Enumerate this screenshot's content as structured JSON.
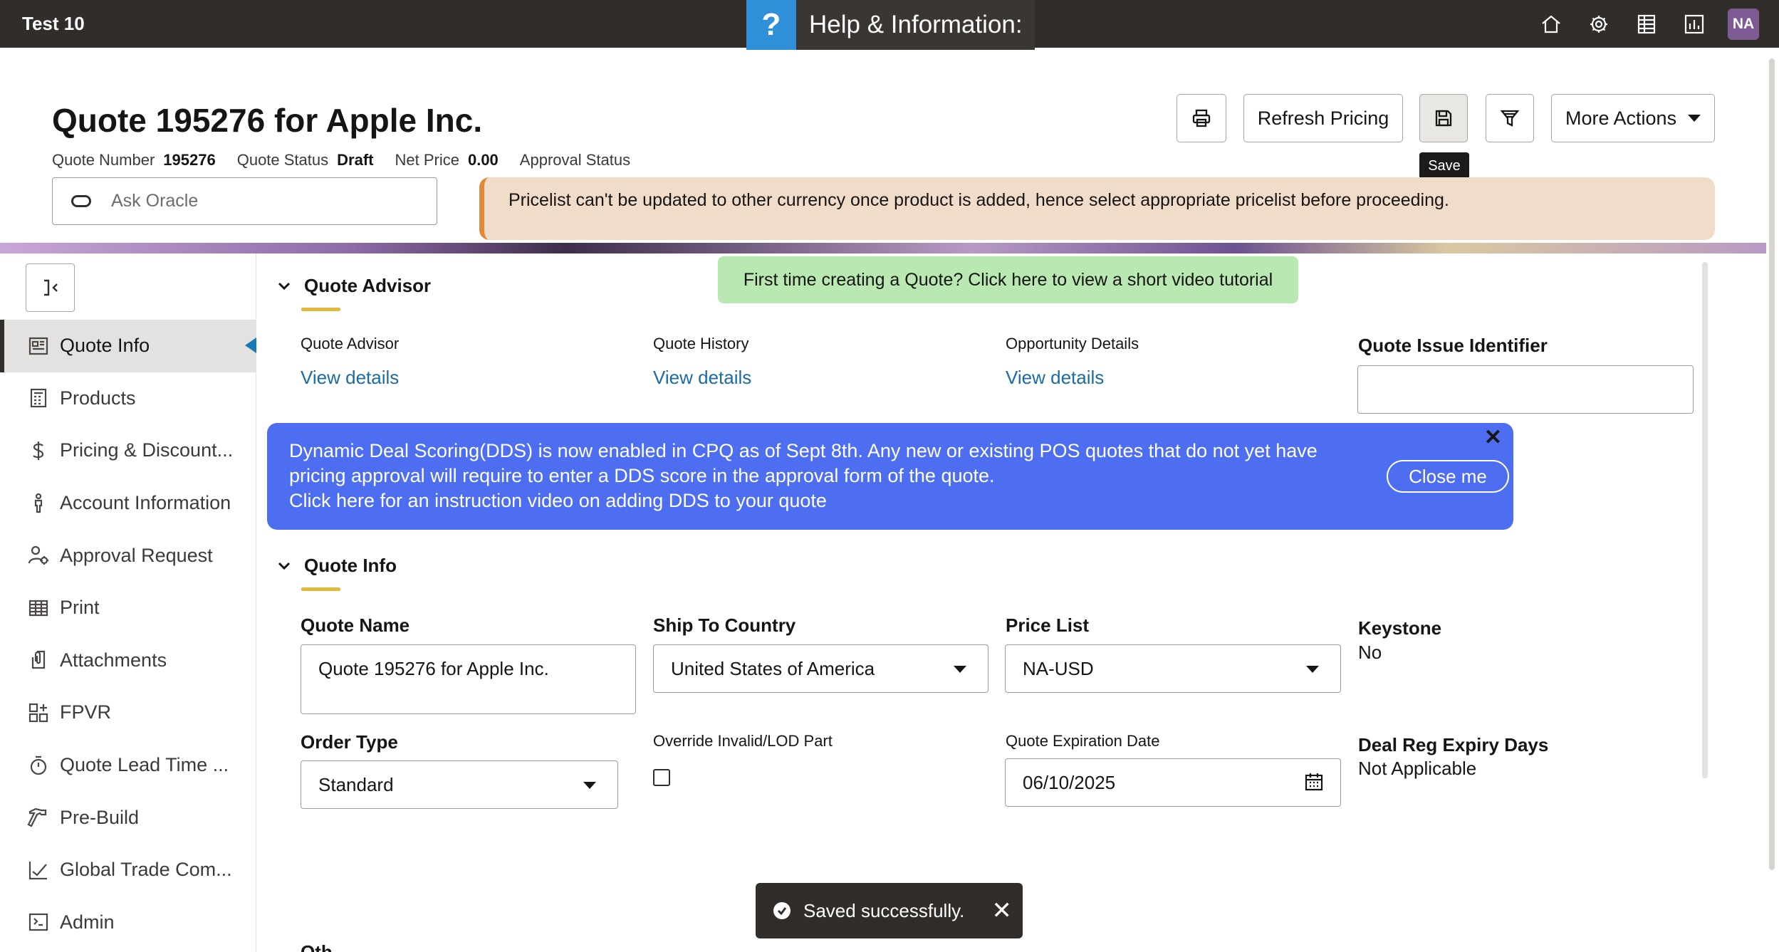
{
  "app": {
    "name": "Test 10"
  },
  "help": {
    "icon": "?",
    "label": "Help & Information:"
  },
  "topbar_icons": [
    "home-icon",
    "gear-icon",
    "grid-icon",
    "chart-icon"
  ],
  "user": {
    "initials": "NA"
  },
  "page": {
    "title": "Quote 195276 for Apple Inc.",
    "meta": [
      {
        "label": "Quote Number",
        "value": "195276"
      },
      {
        "label": "Quote Status",
        "value": "Draft"
      },
      {
        "label": "Net Price",
        "value": "0.00"
      },
      {
        "label": "Approval Status",
        "value": ""
      }
    ]
  },
  "ask": {
    "placeholder": "Ask Oracle"
  },
  "toolbar": {
    "refresh_label": "Refresh Pricing",
    "more_label": "More Actions",
    "save_tooltip": "Save"
  },
  "banners": {
    "pricelist": "Pricelist can't be updated to other currency once product is added, hence select appropriate pricelist before proceeding.",
    "tutorial": "First time creating a Quote? Click here to view a short video tutorial",
    "dds_lines": [
      "Dynamic Deal Scoring(DDS) is now enabled in CPQ as of Sept 8th. Any new or existing POS quotes that do not yet have",
      "pricing approval will require to enter a DDS score in the approval form of the quote.",
      "Click here for an instruction video on adding DDS to your quote"
    ],
    "dds_close_x": "✕",
    "dds_close_label": "Close me"
  },
  "sidebar": {
    "items": [
      {
        "label": "Quote Info",
        "icon": "quote-info-icon"
      },
      {
        "label": "Products",
        "icon": "products-icon"
      },
      {
        "label": "Pricing & Discount...",
        "icon": "dollar-icon"
      },
      {
        "label": "Account Information",
        "icon": "person-icon"
      },
      {
        "label": "Approval Request",
        "icon": "approval-icon"
      },
      {
        "label": "Print",
        "icon": "table-icon"
      },
      {
        "label": "Attachments",
        "icon": "attachment-icon"
      },
      {
        "label": "FPVR",
        "icon": "widgets-icon"
      },
      {
        "label": "Quote Lead Time ...",
        "icon": "timer-icon"
      },
      {
        "label": "Pre-Build",
        "icon": "hammer-icon"
      },
      {
        "label": "Global Trade Com...",
        "icon": "check-icon"
      },
      {
        "label": "Admin",
        "icon": "admin-icon"
      }
    ]
  },
  "quote_advisor": {
    "title": "Quote Advisor",
    "columns": [
      {
        "label": "Quote Advisor",
        "link": "View details"
      },
      {
        "label": "Quote History",
        "link": "View details"
      },
      {
        "label": "Opportunity Details",
        "link": "View details"
      }
    ],
    "issue_identifier": {
      "label": "Quote Issue Identifier",
      "value": ""
    }
  },
  "quote_info": {
    "title": "Quote Info",
    "quote_name": {
      "label": "Quote Name",
      "value": "Quote 195276 for Apple Inc."
    },
    "ship_to_country": {
      "label": "Ship To Country",
      "value": "United States of America"
    },
    "price_list": {
      "label": "Price List",
      "value": "NA-USD"
    },
    "keystone": {
      "label": "Keystone",
      "value": "No"
    },
    "order_type": {
      "label": "Order Type",
      "value": "Standard"
    },
    "override": {
      "label": "Override Invalid/LOD Part",
      "checked": false
    },
    "expiration": {
      "label": "Quote Expiration Date",
      "value": "06/10/2025"
    },
    "deal_reg": {
      "label": "Deal Reg Expiry Days",
      "value": "Not Applicable"
    }
  },
  "next_section_partial": "Oth",
  "toast": {
    "message": "Saved successfully.",
    "close": "✕"
  }
}
